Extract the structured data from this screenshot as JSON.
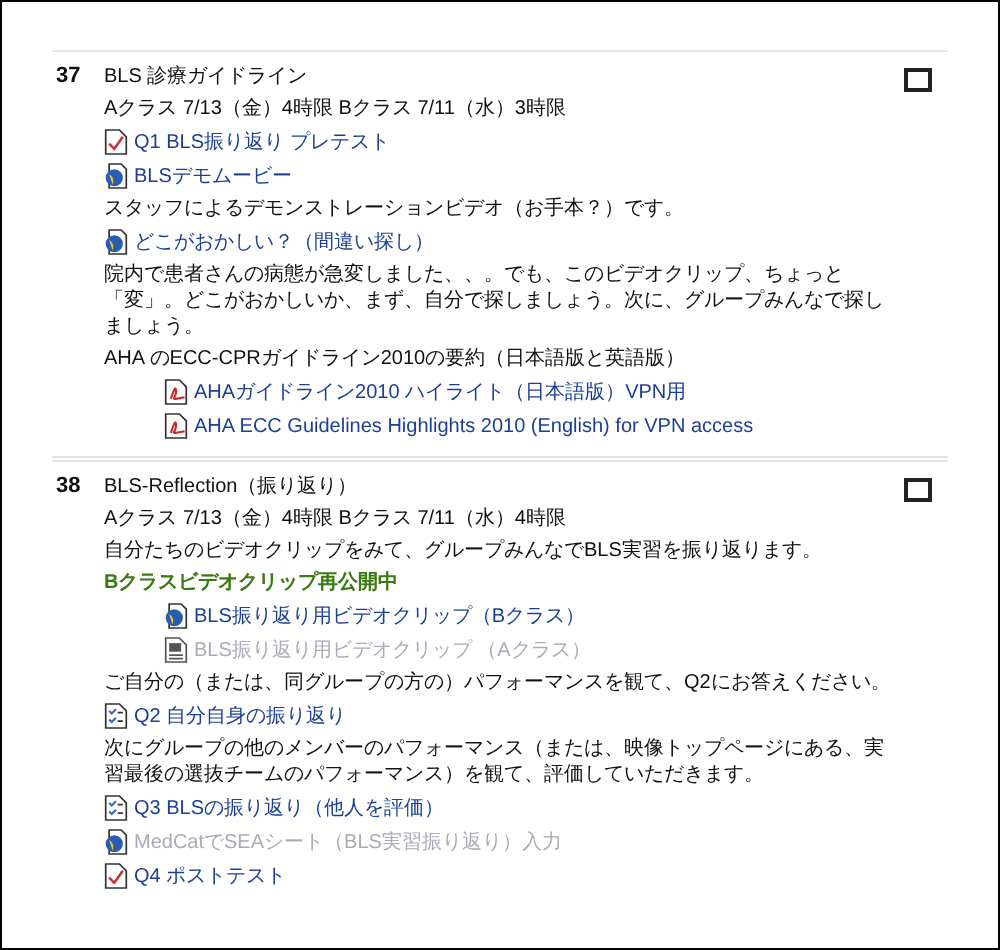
{
  "sections": [
    {
      "number": "37",
      "checked": false,
      "items": [
        {
          "kind": "text",
          "text": "BLS 診療ガイドライン"
        },
        {
          "kind": "text",
          "text": "Aクラス 7/13（金）4時限 Bクラス 7/11（水）3時限"
        },
        {
          "kind": "quiz",
          "text": "Q1 BLS振り返り  プレテスト",
          "disabled": false,
          "indented": false
        },
        {
          "kind": "video",
          "text": "BLSデモムービー",
          "disabled": false,
          "indented": false
        },
        {
          "kind": "text",
          "text": "スタッフによるデモンストレーションビデオ（お手本？）です。"
        },
        {
          "kind": "video",
          "text": "どこがおかしい？（間違い探し）",
          "disabled": false,
          "indented": false
        },
        {
          "kind": "text",
          "text": "院内で患者さんの病態が急変しました、、。でも、このビデオクリップ、ちょっと「変」。どこがおかしいか、まず、自分で探しましょう。次に、グループみんなで探しましょう。"
        },
        {
          "kind": "text",
          "text": "AHA のECC-CPRガイドライン2010の要約（日本語版と英語版）"
        },
        {
          "kind": "pdf",
          "text": "AHAガイドライン2010 ハイライト（日本語版）VPN用",
          "disabled": false,
          "indented": true
        },
        {
          "kind": "pdf",
          "text": "AHA ECC Guidelines Highlights 2010 (English) for VPN access",
          "disabled": false,
          "indented": true
        }
      ]
    },
    {
      "number": "38",
      "checked": false,
      "items": [
        {
          "kind": "text",
          "text": "BLS-Reflection（振り返り）"
        },
        {
          "kind": "text",
          "text": "Aクラス 7/13（金）4時限 Bクラス 7/11（水）4時限"
        },
        {
          "kind": "text",
          "text": "自分たちのビデオクリップをみて、グループみんなでBLS実習を振り返ります。"
        },
        {
          "kind": "highlight",
          "text": "Bクラスビデオクリップ再公開中"
        },
        {
          "kind": "video",
          "text": "BLS振り返り用ビデオクリップ（Bクラス）",
          "disabled": false,
          "indented": true
        },
        {
          "kind": "page",
          "text": "BLS振り返り用ビデオクリップ （Aクラス）",
          "disabled": true,
          "indented": true
        },
        {
          "kind": "text",
          "text": "ご自分の（または、同グループの方の）パフォーマンスを観て、Q2にお答えください。"
        },
        {
          "kind": "survey",
          "text": "Q2 自分自身の振り返り",
          "disabled": false,
          "indented": false
        },
        {
          "kind": "text",
          "text": "次にグループの他のメンバーのパフォーマンス（または、映像トップページにある、実習最後の選抜チームのパフォーマンス）を観て、評価していただきます。"
        },
        {
          "kind": "survey",
          "text": "Q3 BLSの振り返り（他人を評価）",
          "disabled": false,
          "indented": false
        },
        {
          "kind": "video",
          "text": "MedCatでSEAシート（BLS実習振り返り）入力",
          "disabled": true,
          "indented": false
        },
        {
          "kind": "quiz",
          "text": "Q4 ポストテスト",
          "disabled": false,
          "indented": false
        }
      ]
    }
  ]
}
